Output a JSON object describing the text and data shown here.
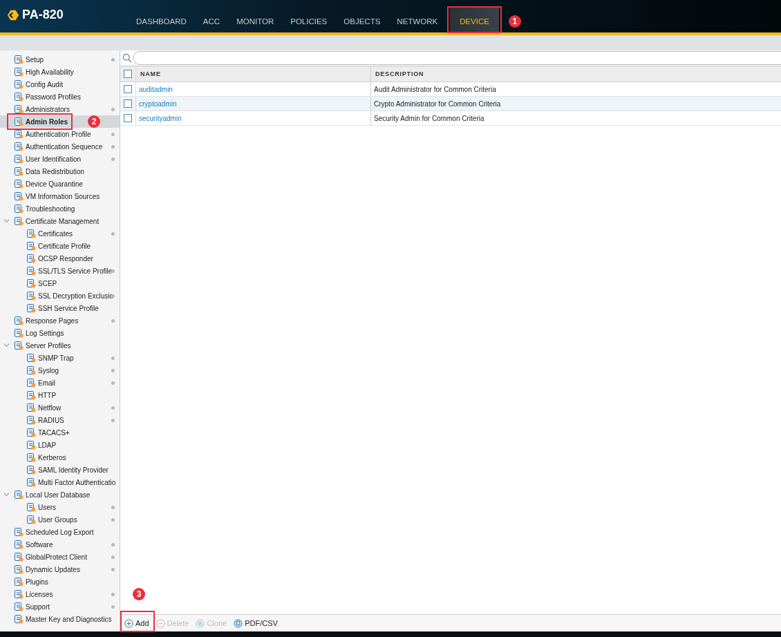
{
  "header": {
    "product": "PA-820"
  },
  "tabs": [
    {
      "label": "DASHBOARD",
      "selected": false
    },
    {
      "label": "ACC",
      "selected": false
    },
    {
      "label": "MONITOR",
      "selected": false
    },
    {
      "label": "POLICIES",
      "selected": false
    },
    {
      "label": "OBJECTS",
      "selected": false
    },
    {
      "label": "NETWORK",
      "selected": false
    },
    {
      "label": "DEVICE",
      "selected": true,
      "callout": "1"
    }
  ],
  "sidebar": {
    "items": [
      {
        "label": "Setup",
        "dot": true,
        "selected": false
      },
      {
        "label": "High Availability",
        "dot": false,
        "selected": false
      },
      {
        "label": "Config Audit",
        "dot": false,
        "selected": false
      },
      {
        "label": "Password Profiles",
        "dot": false,
        "selected": false
      },
      {
        "label": "Administrators",
        "dot": true,
        "selected": false
      },
      {
        "label": "Admin Roles",
        "dot": false,
        "selected": true,
        "callout": "2"
      },
      {
        "label": "Authentication Profile",
        "dot": true,
        "selected": false
      },
      {
        "label": "Authentication Sequence",
        "dot": true,
        "selected": false
      },
      {
        "label": "User Identification",
        "dot": true,
        "selected": false
      },
      {
        "label": "Data Redistribution",
        "dot": false,
        "selected": false
      },
      {
        "label": "Device Quarantine",
        "dot": false,
        "selected": false
      },
      {
        "label": "VM Information Sources",
        "dot": false,
        "selected": false
      },
      {
        "label": "Troubleshooting",
        "dot": false,
        "selected": false
      },
      {
        "label": "Certificate Management",
        "dot": false,
        "selected": false,
        "expanded": true,
        "children": [
          {
            "label": "Certificates",
            "dot": true,
            "selected": false
          },
          {
            "label": "Certificate Profile",
            "dot": false,
            "selected": false
          },
          {
            "label": "OCSP Responder",
            "dot": false,
            "selected": false
          },
          {
            "label": "SSL/TLS Service Profile",
            "dot": true,
            "selected": false
          },
          {
            "label": "SCEP",
            "dot": false,
            "selected": false
          },
          {
            "label": "SSL Decryption Exclusio",
            "dot": true,
            "selected": false
          },
          {
            "label": "SSH Service Profile",
            "dot": false,
            "selected": false
          }
        ]
      },
      {
        "label": "Response Pages",
        "dot": true,
        "selected": false
      },
      {
        "label": "Log Settings",
        "dot": false,
        "selected": false
      },
      {
        "label": "Server Profiles",
        "dot": false,
        "selected": false,
        "expanded": true,
        "children": [
          {
            "label": "SNMP Trap",
            "dot": true,
            "selected": false
          },
          {
            "label": "Syslog",
            "dot": true,
            "selected": false
          },
          {
            "label": "Email",
            "dot": true,
            "selected": false
          },
          {
            "label": "HTTP",
            "dot": false,
            "selected": false
          },
          {
            "label": "Netflow",
            "dot": true,
            "selected": false
          },
          {
            "label": "RADIUS",
            "dot": true,
            "selected": false
          },
          {
            "label": "TACACS+",
            "dot": false,
            "selected": false
          },
          {
            "label": "LDAP",
            "dot": false,
            "selected": false
          },
          {
            "label": "Kerberos",
            "dot": false,
            "selected": false
          },
          {
            "label": "SAML Identity Provider",
            "dot": false,
            "selected": false
          },
          {
            "label": "Multi Factor Authenticatio",
            "dot": false,
            "selected": false
          }
        ]
      },
      {
        "label": "Local User Database",
        "dot": false,
        "selected": false,
        "expanded": true,
        "children": [
          {
            "label": "Users",
            "dot": true,
            "selected": false
          },
          {
            "label": "User Groups",
            "dot": true,
            "selected": false
          }
        ]
      },
      {
        "label": "Scheduled Log Export",
        "dot": false,
        "selected": false
      },
      {
        "label": "Software",
        "dot": true,
        "selected": false
      },
      {
        "label": "GlobalProtect Client",
        "dot": true,
        "selected": false
      },
      {
        "label": "Dynamic Updates",
        "dot": true,
        "selected": false
      },
      {
        "label": "Plugins",
        "dot": false,
        "selected": false
      },
      {
        "label": "Licenses",
        "dot": true,
        "selected": false
      },
      {
        "label": "Support",
        "dot": true,
        "selected": false
      },
      {
        "label": "Master Key and Diagnostics",
        "dot": false,
        "selected": false
      }
    ]
  },
  "table": {
    "columns": [
      "NAME",
      "DESCRIPTION"
    ],
    "header_checked": false,
    "rows": [
      {
        "name": "auditadmin",
        "description": "Audit Administrator for Common Criteria",
        "checked": false
      },
      {
        "name": "cryptoadmin",
        "description": "Crypto Administrator for Common Criteria",
        "checked": false
      },
      {
        "name": "securityadmin",
        "description": "Security Admin for Common Criteria",
        "checked": false
      }
    ]
  },
  "toolbar": [
    {
      "kind": "add",
      "label": "Add",
      "disabled": false,
      "callout": "3"
    },
    {
      "kind": "delete",
      "label": "Delete",
      "disabled": true
    },
    {
      "kind": "clone",
      "label": "Clone",
      "disabled": true
    },
    {
      "kind": "export",
      "label": "PDF/CSV",
      "disabled": false
    }
  ]
}
